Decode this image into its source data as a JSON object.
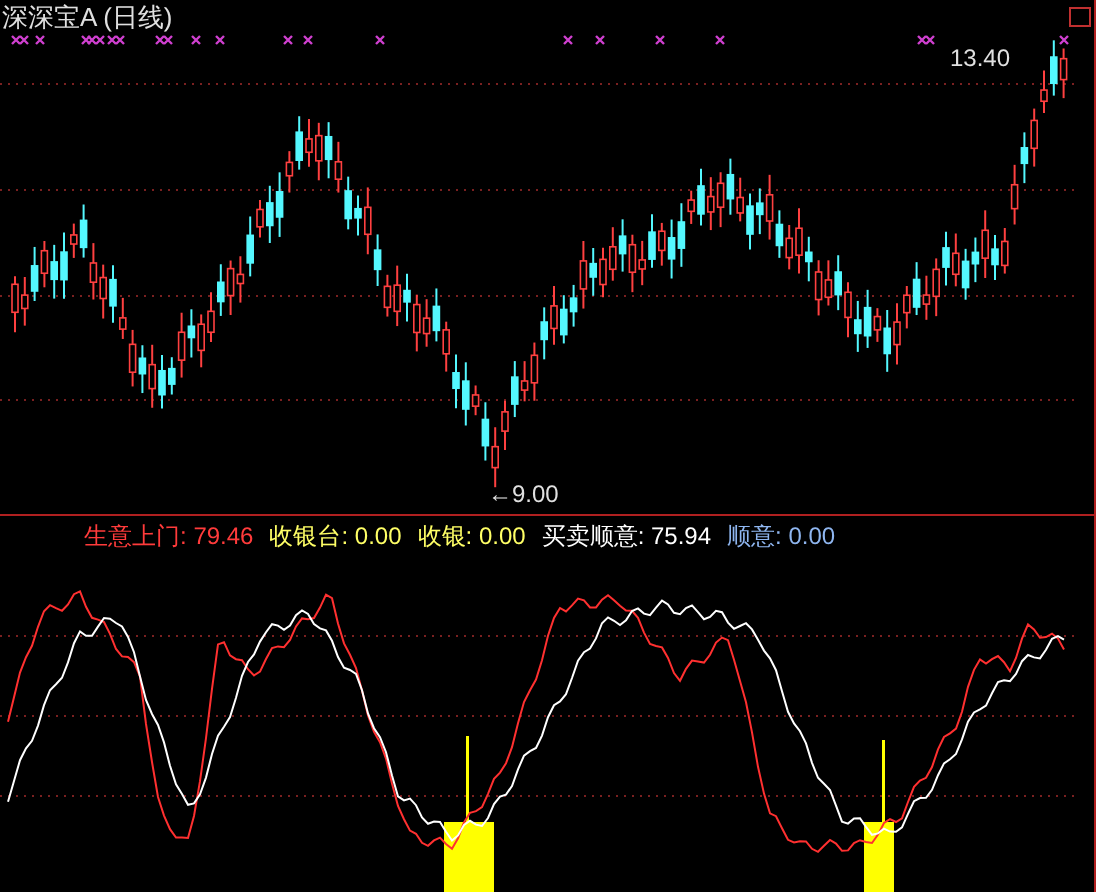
{
  "chart_title": "深深宝A (日线)",
  "price_labels": {
    "high": "13.40",
    "low": "←9.00"
  },
  "indicator_legend": [
    {
      "label": "生意上门:",
      "value": "79.46",
      "color": "#ff3b3b"
    },
    {
      "label": "收银台:",
      "value": "0.00",
      "color": "#ffff66"
    },
    {
      "label": "收银:",
      "value": "0.00",
      "color": "#ffff66"
    },
    {
      "label": "买卖顺意:",
      "value": "75.94",
      "color": "#ffffff"
    },
    {
      "label": "顺意:",
      "value": "0.00",
      "color": "#8fb6f0"
    }
  ]
}
